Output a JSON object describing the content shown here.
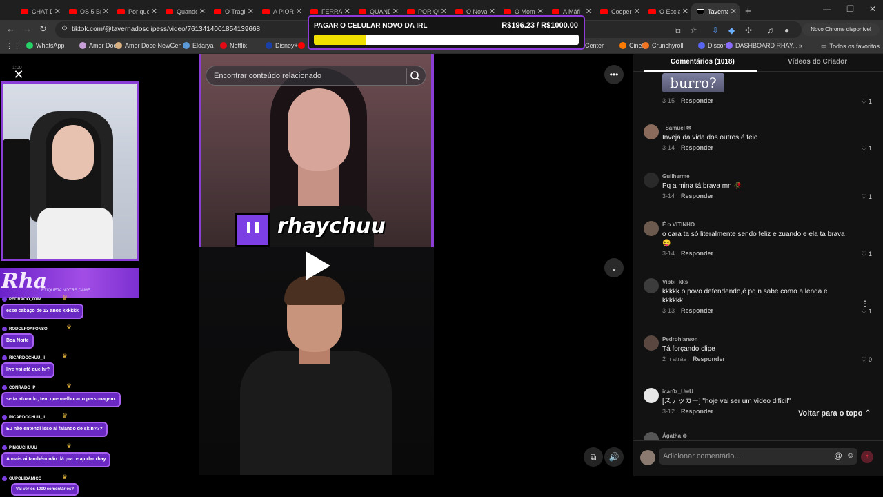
{
  "tabs": [
    {
      "title": "CHAT D",
      "active": false
    },
    {
      "title": "OS 5 Br",
      "active": false
    },
    {
      "title": "Por que",
      "active": false
    },
    {
      "title": "Quando",
      "active": false
    },
    {
      "title": "O Trági",
      "active": false
    },
    {
      "title": "A PIOR",
      "active": false
    },
    {
      "title": "FERRA",
      "active": false
    },
    {
      "title": "QUAND",
      "active": false
    },
    {
      "title": "POR QU",
      "active": false
    },
    {
      "title": "O Nova",
      "active": false
    },
    {
      "title": "O Mom",
      "active": false
    },
    {
      "title": "A Máfi",
      "active": false
    },
    {
      "title": "Cooper",
      "active": false
    },
    {
      "title": "O Escla",
      "active": false
    },
    {
      "title": "Taverna",
      "active": true
    }
  ],
  "address": {
    "url": "tiktok.com/@tavernadosclipess/video/7613414001854139668"
  },
  "chrome_update_label": "Novo Chrome disponível",
  "bookmarks": [
    {
      "label": "WhatsApp",
      "color": "#25d366"
    },
    {
      "label": "Amor Doce",
      "color": "#c7a0d8"
    },
    {
      "label": "Amor Doce NewGen",
      "color": "#d9b07f"
    },
    {
      "label": "Eldarya",
      "color": "#5a9ad8"
    },
    {
      "label": "Netflix",
      "color": "#e50914"
    },
    {
      "label": "Disney+",
      "color": "#1a3fa8"
    },
    {
      "label": "Yo",
      "color": "#ff0000"
    },
    {
      "label": "Center",
      "color": ""
    },
    {
      "label": "Cinefy",
      "color": "#ff7a00"
    },
    {
      "label": "Crunchyroll",
      "color": "#f47521"
    },
    {
      "label": "Discord",
      "color": "#5865f2"
    },
    {
      "label": "DASHBOARD RHAY...",
      "color": "#8a6cff"
    }
  ],
  "bookmarks_all": "Todos os favoritos",
  "goal": {
    "title": "PAGAR O CELULAR NOVO DA IRL",
    "amount": "R$196.23 / R$1000.00",
    "progress": 0.196,
    "fill_color": "#f0e000"
  },
  "webcam": {
    "timer": "1:00"
  },
  "name_banner": {
    "text": "Rha",
    "subtitle": "ETIQUETA NOTRE DAME"
  },
  "chat": [
    {
      "user": "PEDRAOO_00IM",
      "message": "esse cabaço de 13 anos kkkkkk"
    },
    {
      "user": "RODOLFOAFONSO",
      "message": "Boa Noite"
    },
    {
      "user": "RICARDOCHUU_II",
      "message": "live vai até que hr?"
    },
    {
      "user": "CONRADO_P",
      "message": "se ta atuando, tem que melhorar o personagem."
    },
    {
      "user": "RICARDOCHUU_II",
      "message": "Eu não entendi isso ai falando de skin???"
    },
    {
      "user": "PINGUCHUUU",
      "message": "A mais ai também não dá pra te ajudar rhay"
    },
    {
      "user": "GUPOLIDAMICO",
      "message": "Vai ver os 1000 comentários?"
    }
  ],
  "video": {
    "search_placeholder": "Encontrar conteúdo relacionado",
    "streamer_name": "rhaychuu"
  },
  "comments_panel": {
    "tab_comments": "Comentários (1018)",
    "tab_creator_videos": "Vídeos do Criador",
    "sticker_text": "burro?",
    "first_meta": {
      "date": "3-15",
      "reply": "Responder",
      "likes": "1"
    },
    "comments": [
      {
        "user": "_Samuel ✉",
        "text": "Inveja da vida dos outros é feio",
        "date": "3-14",
        "reply": "Responder",
        "likes": "1",
        "avatar_color": "#8a6a5a"
      },
      {
        "user": "Guilherme",
        "text": "Pq a mina tá brava mn 🥀",
        "date": "3-14",
        "reply": "Responder",
        "likes": "1",
        "avatar_color": "#2a2a2a"
      },
      {
        "user": "É o VITINHO",
        "text": "o cara ta só literalmente sendo feliz e zuando e ela ta brava😝",
        "date": "3-14",
        "reply": "Responder",
        "likes": "1",
        "avatar_color": "#6d5a4f"
      },
      {
        "user": "Vibbi_kks",
        "text": "kkkkk o povo defendendo,é pq n sabe como a lenda é kkkkkk",
        "date": "3-13",
        "reply": "Responder",
        "likes": "1",
        "avatar_color": "#3c3c3c"
      },
      {
        "user": "Pedrohlarson",
        "text": "Tá forçando clipe",
        "date": "2 h atrás",
        "reply": "Responder",
        "likes": "0",
        "avatar_color": "#5a4840"
      },
      {
        "user": "icar0z_UwU",
        "text": "[ステッカー] \"hoje vai ser um vídeo difícil\"",
        "date": "3-12",
        "reply": "Responder",
        "likes": "",
        "avatar_color": "#e8e8e8"
      },
      {
        "user": "Ágatha ⊜",
        "text": "",
        "date": "",
        "reply": "",
        "likes": "",
        "avatar_color": "#555"
      }
    ],
    "back_to_top": "Voltar para o topo",
    "comment_placeholder": "Adicionar comentário..."
  }
}
